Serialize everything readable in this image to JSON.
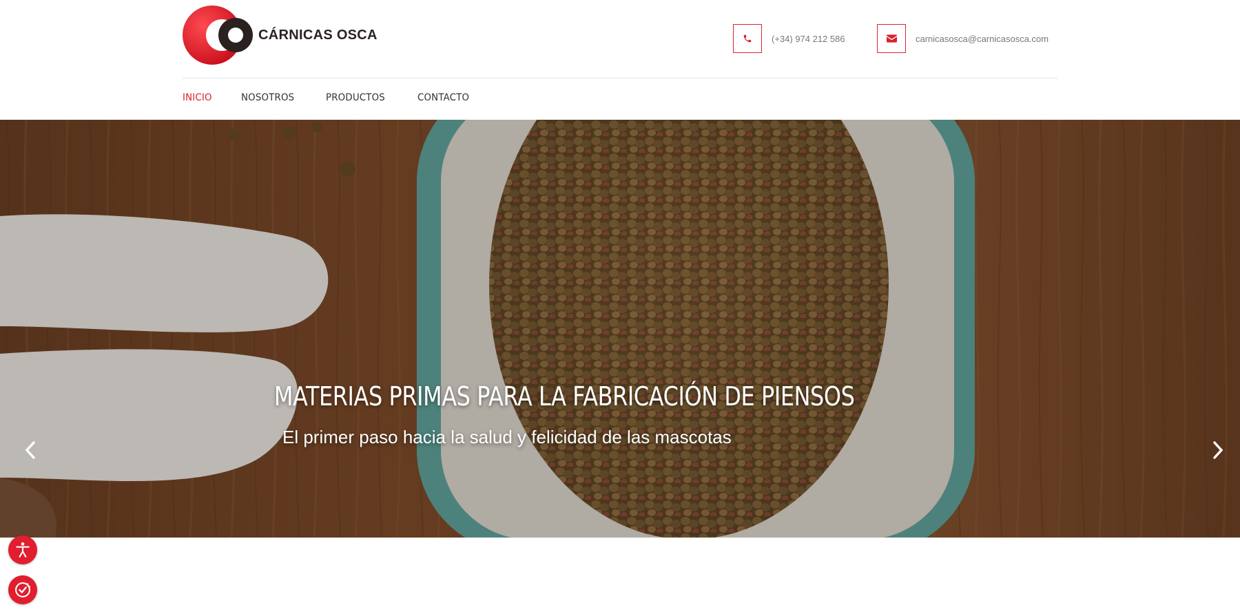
{
  "brand": {
    "name": "CÁRNICAS OSCA",
    "colors": {
      "accent": "#d9232d",
      "text": "#2b2220"
    }
  },
  "contact": {
    "phone": "(+34) 974 212 586",
    "email": "carnicasosca@carnicasosca.com",
    "phone_icon": "phone-icon",
    "email_icon": "envelope-icon"
  },
  "nav": {
    "items": [
      {
        "label": "INICIO",
        "active": true
      },
      {
        "label": "NOSOTROS",
        "active": false
      },
      {
        "label": "PRODUCTOS",
        "active": false
      },
      {
        "label": "CONTACTO",
        "active": false
      }
    ]
  },
  "hero": {
    "title": "MATERIAS PRIMAS PARA LA FABRICACIÓN DE PIENSOS",
    "subtitle": "El primer paso hacia la salud y felicidad de las mascotas",
    "prev_icon": "chevron-left-icon",
    "next_icon": "chevron-right-icon"
  },
  "widgets": {
    "accessibility_icon": "accessibility-icon",
    "cookie_icon": "cookie-settings-icon"
  }
}
